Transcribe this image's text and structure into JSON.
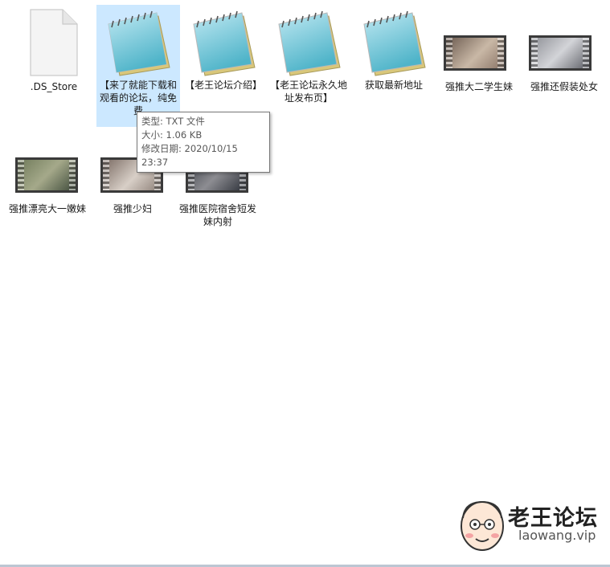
{
  "files": [
    {
      "name": ".DS_Store",
      "type": "blank"
    },
    {
      "name": "【来了就能下载和观看的论坛，纯免费",
      "type": "notepad",
      "selected": true
    },
    {
      "name": "【老王论坛介绍】",
      "type": "notepad"
    },
    {
      "name": "【老王论坛永久地址发布页】",
      "type": "notepad"
    },
    {
      "name": "获取最新地址",
      "type": "notepad"
    },
    {
      "name": "强推大二学生妹",
      "type": "video"
    },
    {
      "name": "强推还假装处女",
      "type": "video"
    },
    {
      "name": "强推漂亮大一嫩妹",
      "type": "video"
    },
    {
      "name": "强推少妇",
      "type": "video"
    },
    {
      "name": "强推医院宿舍短发妹内射",
      "type": "video"
    }
  ],
  "tooltip": {
    "type_line": "类型: TXT 文件",
    "size_line": "大小: 1.06 KB",
    "date_line": "修改日期: 2020/10/15 23:37"
  },
  "watermark": {
    "title": "老王论坛",
    "url": "laowang.vip"
  },
  "colors": {
    "selection": "#cce8ff",
    "tooltip_border": "#767676"
  }
}
